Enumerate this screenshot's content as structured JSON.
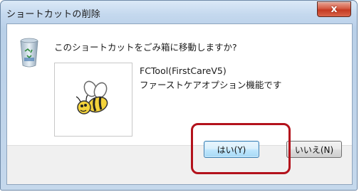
{
  "window": {
    "title": "ショートカットの削除",
    "close_label": "x"
  },
  "dialog": {
    "question": "このショートカットをごみ箱に移動しますか?",
    "item_name": "FCTool(FirstCareV5)",
    "item_description": "ファーストケアオプション機能です",
    "recycle_icon": "recycle-bin-icon",
    "item_icon": "bee-icon"
  },
  "buttons": {
    "yes_label": "はい(Y)",
    "no_label": "いいえ(N)"
  },
  "colors": {
    "highlight": "#b3121c",
    "close_button": "#c43a22",
    "default_button_border": "#3c7fb1"
  }
}
